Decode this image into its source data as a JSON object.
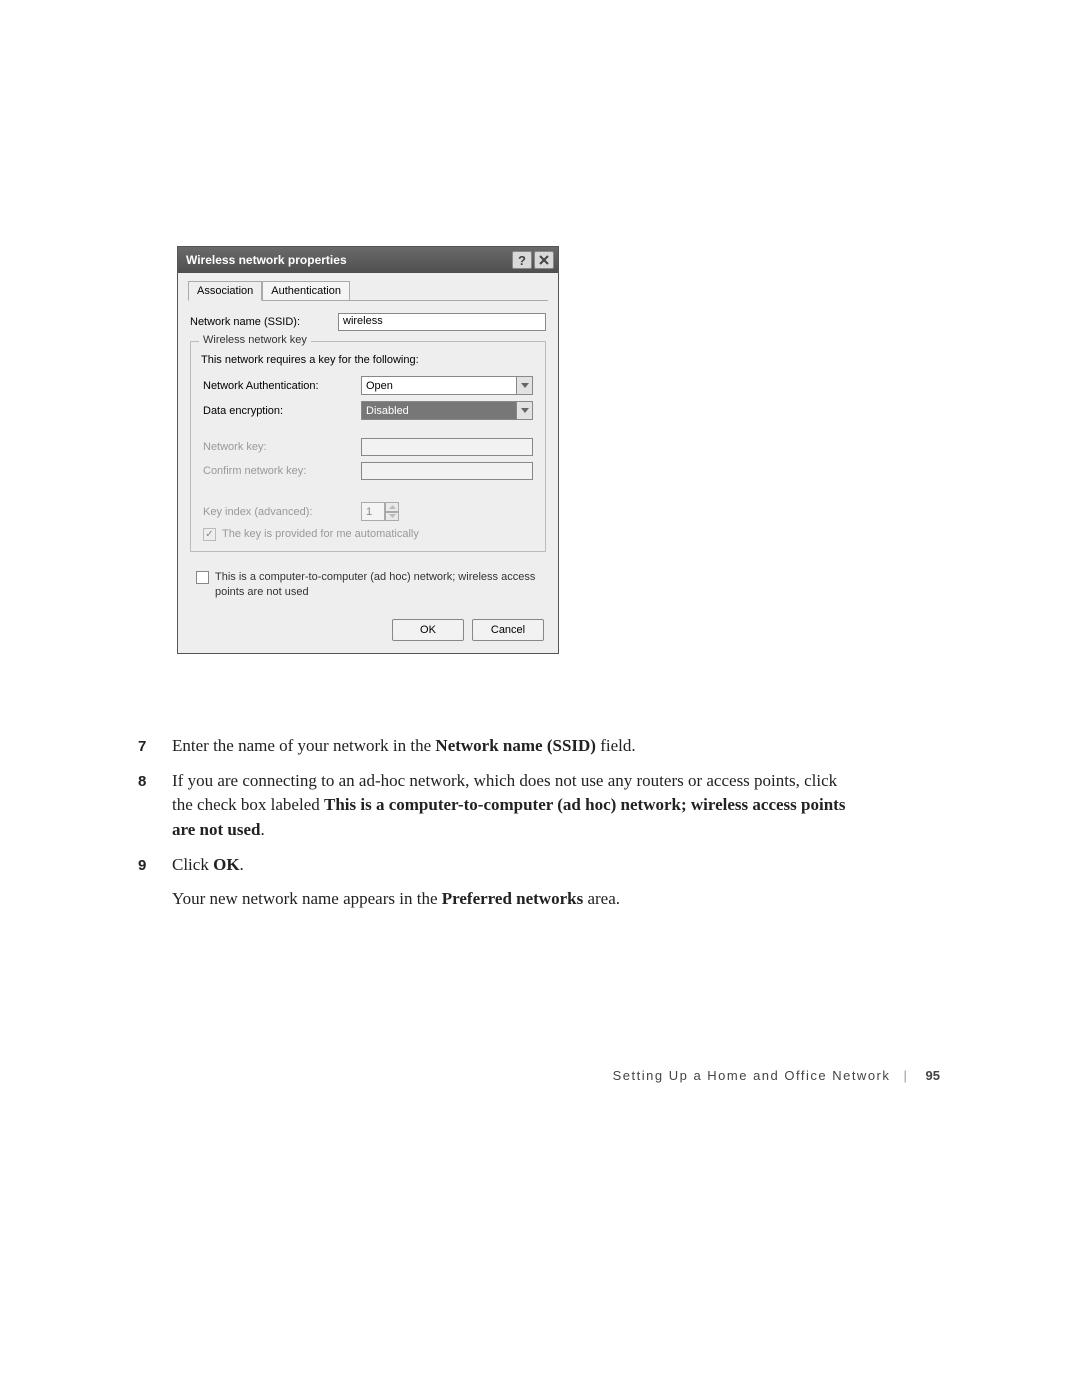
{
  "dialog": {
    "title": "Wireless network properties",
    "tabs": {
      "association": "Association",
      "authentication": "Authentication"
    },
    "ssid_label": "Network name (SSID):",
    "ssid_value": "wireless",
    "fieldset_legend": "Wireless network key",
    "hint": "This network requires a key for the following:",
    "auth_label": "Network Authentication:",
    "auth_value": "Open",
    "enc_label": "Data encryption:",
    "enc_value": "Disabled",
    "key_label": "Network key:",
    "confirm_label": "Confirm network key:",
    "index_label": "Key index (advanced):",
    "index_value": "1",
    "auto_key_label": "The key is provided for me automatically",
    "adhoc_label": "This is a computer-to-computer (ad hoc) network; wireless access points are not used",
    "ok": "OK",
    "cancel": "Cancel"
  },
  "steps": {
    "s7": {
      "num": "7",
      "a": "Enter the name of your network in the ",
      "b": "Network name (SSID)",
      "c": " field."
    },
    "s8": {
      "num": "8",
      "a": "If you are connecting to an ad-hoc network, which does not use any routers or access points, click the check box labeled ",
      "b": "This is a computer-to-computer (ad hoc) network; wireless access points are not used",
      "c": "."
    },
    "s9": {
      "num": "9",
      "a": "Click ",
      "b": "OK",
      "c": "."
    },
    "cont": {
      "a": "Your new network name appears in the ",
      "b": "Preferred networks",
      "c": " area."
    }
  },
  "footer": {
    "section": "Setting Up a Home and Office Network",
    "page": "95"
  }
}
